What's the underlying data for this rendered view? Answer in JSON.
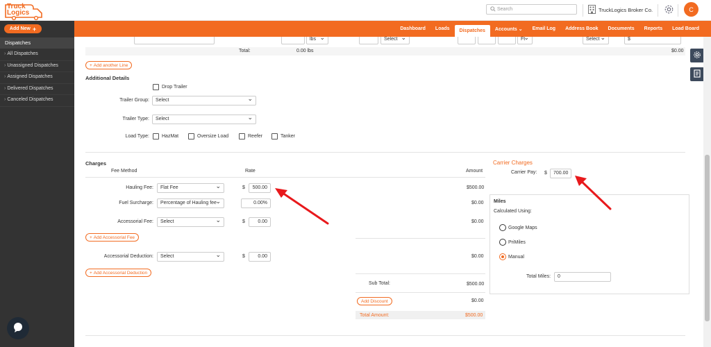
{
  "brand": {
    "logo_line1": "Truck",
    "logo_line2": "Logics"
  },
  "header": {
    "search_placeholder": "Search",
    "company_name": "TruckLogics Broker Co.",
    "avatar_initial": "C"
  },
  "sidebar": {
    "add_new_label": "Add New",
    "section_title": "Dispatches",
    "items": [
      {
        "label": "All Dispatches"
      },
      {
        "label": "Unassigned Dispatches"
      },
      {
        "label": "Assigned Dispatches"
      },
      {
        "label": "Delivered Dispatches"
      },
      {
        "label": "Canceled Dispatches"
      }
    ]
  },
  "nav": {
    "items": [
      {
        "label": "Dashboard"
      },
      {
        "label": "Loads"
      },
      {
        "label": "Dispatches"
      },
      {
        "label": "Accounts ⌄"
      },
      {
        "label": "Email Log"
      },
      {
        "label": "Address Book"
      },
      {
        "label": "Documents"
      },
      {
        "label": "Reports"
      },
      {
        "label": "Load Board"
      }
    ],
    "active_index": 2
  },
  "shipment_row": {
    "unit_lbs": "lbs",
    "select_placeholder": "Select",
    "unit_ft": "Ft",
    "currency": "$",
    "total_label": "Total:",
    "total_weight": "0.00 lbs",
    "total_amount": "$0.00"
  },
  "add_line_label": "Add another Line",
  "additional_details": {
    "title": "Additional Details",
    "drop_trailer_label": "Drop Trailer",
    "trailer_group_label": "Trailer Group:",
    "trailer_group_value": "Select",
    "trailer_type_label": "Trailer Type:",
    "trailer_type_value": "Select",
    "load_type_label": "Load Type:",
    "load_types": [
      "HazMat",
      "Oversize Load",
      "Reefer",
      "Tanker"
    ]
  },
  "charges": {
    "title": "Charges",
    "col_fee_method": "Fee Method",
    "col_rate": "Rate",
    "col_amount": "Amount",
    "currency": "$",
    "hauling": {
      "label": "Hauling Fee:",
      "method": "Flat Fee",
      "rate": "500.00",
      "amount": "$500.00"
    },
    "fuel": {
      "label": "Fuel Surcharge:",
      "method": "Percentage of Hauling fee",
      "rate": "0.00",
      "rate_suffix": "%",
      "amount": "$0.00"
    },
    "accessorial": {
      "label": "Accessorial Fee:",
      "method": "Select",
      "rate": "0.00",
      "amount": "$0.00"
    },
    "add_accessorial_label": "Add Accessorial Fee",
    "deduction": {
      "label": "Accessorial Deduction:",
      "method": "Select",
      "rate": "0.00",
      "amount": "$0.00"
    },
    "add_deduction_label": "Add Accessorial Deduction",
    "subtotal_label": "Sub Total:",
    "subtotal_value": "$500.00",
    "add_discount_label": "Add Discount",
    "discount_value": "$0.00",
    "total_label": "Total Amount:",
    "total_value": "$500.00"
  },
  "carrier": {
    "title": "Carrier Charges",
    "pay_label": "Carrier Pay:",
    "currency": "$",
    "pay_value": "700.00"
  },
  "miles": {
    "title": "Miles",
    "calc_label": "Calculated Using:",
    "options": [
      "Google Maps",
      "PriMiles",
      "Manual"
    ],
    "selected_index": 2,
    "total_label": "Total Miles:",
    "total_value": "0"
  },
  "colors": {
    "accent": "#f26b21",
    "sidebar": "#333333",
    "arrow": "#e8191c"
  }
}
